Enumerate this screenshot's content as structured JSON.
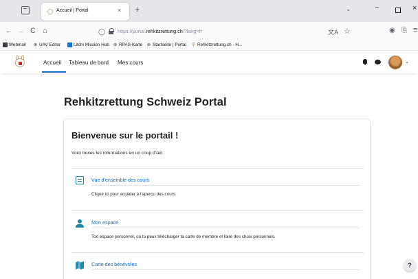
{
  "browser": {
    "tab": {
      "title": "Accueil | Portal",
      "close": "×"
    },
    "new_tab": "+",
    "list_all_tabs": "⌄",
    "window": {
      "minimize": "−",
      "close": "×"
    },
    "nav": {
      "back": "←",
      "forward": "→",
      "reload": "C",
      "home": "⌂"
    },
    "url": {
      "scheme": "https://portal.",
      "host": "rehkitzrettung.ch",
      "path": "/?lang=fr"
    },
    "icons": {
      "translate": "文A",
      "star": "☆",
      "account": "◉",
      "extensions": "⎘",
      "menu": "≡",
      "shield": "◯"
    },
    "bookmarks": [
      {
        "label": "Webmail",
        "icon": "envelope-icon"
      },
      {
        "label": "UAV Editor",
        "icon": "globe-icon"
      },
      {
        "label": "Litchi Mission Hub",
        "icon": "litchi-icon"
      },
      {
        "label": "RPAS-Karte",
        "icon": "globe-icon"
      },
      {
        "label": "Startseite | Portal",
        "icon": "globe-icon"
      },
      {
        "label": "Rehkitzrettung.ch - H...",
        "icon": "rehkitz-icon"
      }
    ]
  },
  "site": {
    "nav": [
      "Accueil",
      "Tableau de bord",
      "Mes cours"
    ],
    "avatar_caret": "⌄"
  },
  "page": {
    "title": "Rehkitzrettung Schweiz Portal",
    "card_title": "Bienvenue sur le portail !",
    "intro": "Voici toutes les informations en un coup d'œil :",
    "items": [
      {
        "title": "Vue d'ensemble des cours",
        "desc": "Clique ici pour accéder à l'aperçu des cours.",
        "icon": "course-overview-icon"
      },
      {
        "title": "Mon espace",
        "desc": "Ton espace personnel, où tu peux télécharger ta carte de membre et faire des choix personnels.",
        "icon": "user-icon"
      },
      {
        "title": "Carte des bénévoles",
        "desc": "",
        "icon": "map-icon"
      }
    ]
  },
  "help": "?"
}
